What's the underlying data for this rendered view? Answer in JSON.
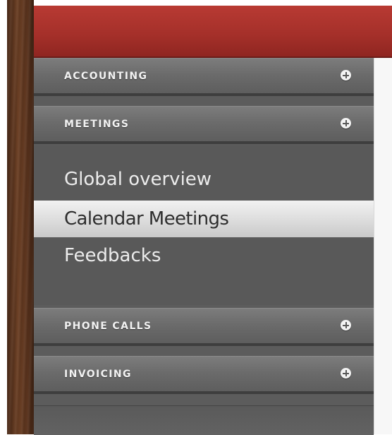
{
  "sidebar": {
    "sections": [
      {
        "title": "ACCOUNTING"
      },
      {
        "title": "MEETINGS"
      },
      {
        "title": "PHONE CALLS"
      },
      {
        "title": "INVOICING"
      }
    ],
    "meetings_items": [
      {
        "label": "Global overview",
        "active": false
      },
      {
        "label": "Calendar Meetings",
        "active": true
      },
      {
        "label": "Feedbacks",
        "active": false
      }
    ]
  },
  "colors": {
    "header_red": "#a5302a",
    "sidebar_gray": "#5c5c5c",
    "active_item": "#dcdcdc"
  },
  "icons": {
    "section_toggle": "plus-circle-icon"
  }
}
